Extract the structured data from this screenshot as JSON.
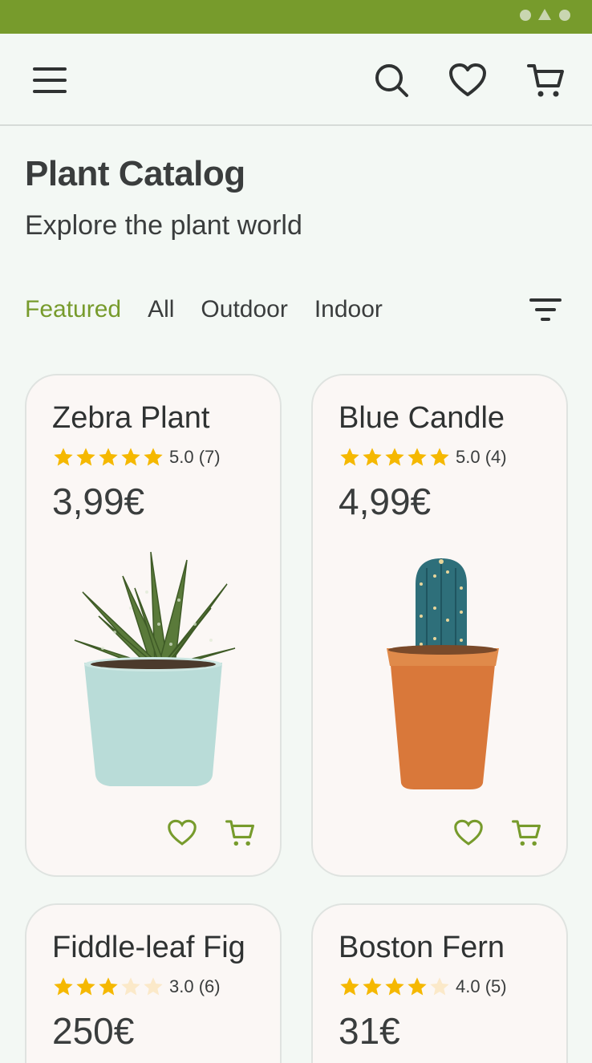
{
  "theme": {
    "accent": "#779b2c",
    "background": "#f3f8f4",
    "card_background": "#fbf7f5",
    "star_color": "#f5b800",
    "star_empty": "#fbe9c9"
  },
  "header": {
    "icons": [
      "menu-icon",
      "search-icon",
      "heart-icon",
      "cart-icon"
    ]
  },
  "page": {
    "title": "Plant Catalog",
    "subtitle": "Explore the plant world"
  },
  "tabs": [
    {
      "label": "Featured",
      "active": true
    },
    {
      "label": "All",
      "active": false
    },
    {
      "label": "Outdoor",
      "active": false
    },
    {
      "label": "Indoor",
      "active": false
    }
  ],
  "products": [
    {
      "name": "Zebra Plant",
      "rating": 5,
      "rating_text": "5.0 (7)",
      "price": "3,99€",
      "pot_color": "#b9dcd8"
    },
    {
      "name": "Blue Candle",
      "rating": 5,
      "rating_text": "5.0 (4)",
      "price": "4,99€",
      "pot_color": "#d9783a"
    },
    {
      "name": "Fiddle-leaf Fig",
      "rating": 3,
      "rating_text": "3.0 (6)",
      "price": "250€"
    },
    {
      "name": "Boston Fern",
      "rating": 4,
      "rating_text": "4.0 (5)",
      "price": "31€"
    }
  ]
}
